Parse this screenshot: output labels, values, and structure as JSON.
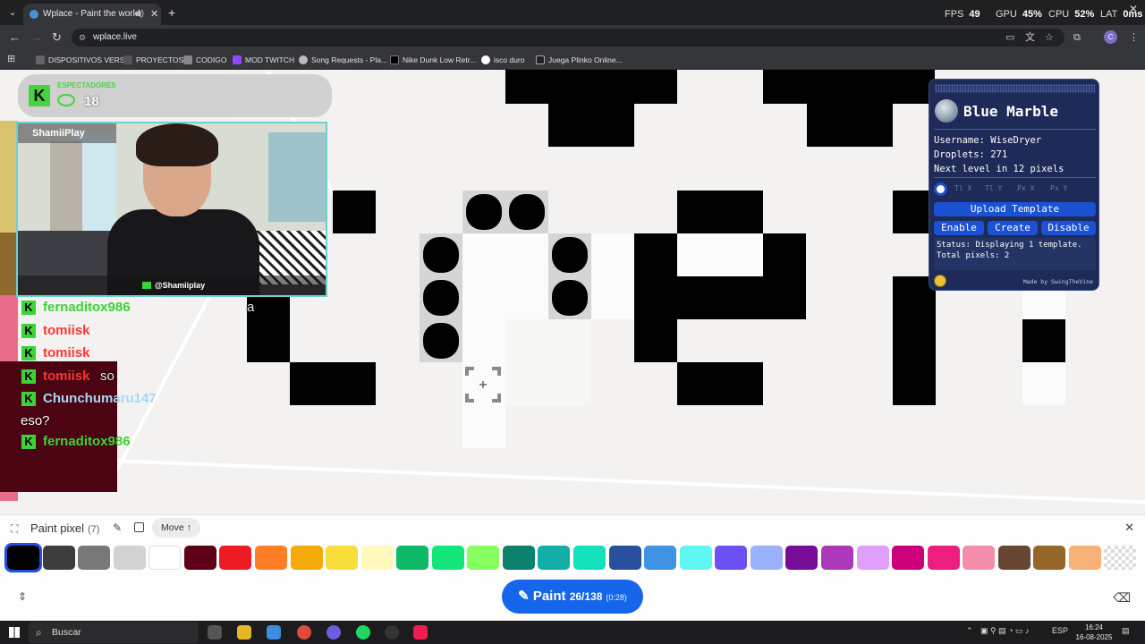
{
  "browser": {
    "tab_title": "Wplace - Paint the world",
    "url": "wplace.live",
    "hud": {
      "fps_label": "FPS",
      "fps": "49",
      "gpu_label": "GPU",
      "gpu": "45%",
      "cpu_label": "CPU",
      "cpu": "52%",
      "lat_label": "LAT",
      "lat": "0ms"
    },
    "profile_initial": "C",
    "bookmarks": [
      "DISPOSITIVOS VERSE",
      "PROYECTOS",
      "CODIGO",
      "MOD TWITCH",
      "Song Requests - Pla...",
      "Nike Dunk Low Retr...",
      "isco duro",
      "Juega Plinko Online..."
    ]
  },
  "stream": {
    "viewers_label": "ESPECTADORES",
    "viewers": "18",
    "streamer_name": "ShamiiPlay",
    "handle": "@Shamiiplay",
    "chat": [
      {
        "user": "fernaditox986",
        "color": "#3cd337",
        "message": "a"
      },
      {
        "user": "tomiisk",
        "color": "#ff3333",
        "message": ""
      },
      {
        "user": "tomiisk",
        "color": "#ff3333",
        "message": ""
      },
      {
        "user": "tomiisk",
        "color": "#ff3333",
        "message": "so"
      },
      {
        "user": "Chunchumaru147",
        "color": "#a7d8f5",
        "message": ""
      }
    ],
    "chat_continuation": "eso?",
    "chat_last": {
      "user": "fernaditox986",
      "color": "#3cd337"
    }
  },
  "blue_marble": {
    "title": "Blue Marble",
    "username": "Username: WiseDryer",
    "droplets": "Droplets: 271",
    "next_level": "Next level in 12 pixels",
    "coord_inputs": [
      "Tl X",
      "Tl Y",
      "Px X",
      "Px Y"
    ],
    "upload_label": "Upload Template",
    "enable_label": "Enable",
    "create_label": "Create",
    "disable_label": "Disable",
    "status_text": "Status: Displaying 1 template.\nTotal pixels: 2",
    "credit": "Made by SwingTheVine"
  },
  "paint_bar": {
    "title": "Paint pixel",
    "count": "(7)",
    "move_label": "Move ↑",
    "paint_label": "Paint",
    "paint_progress": "26/138",
    "paint_timer": "(0:28)",
    "selected_color": "#000000",
    "palette": [
      "#000000",
      "#3c3c3c",
      "#787878",
      "#d2d2d2",
      "#ffffff",
      "#600018",
      "#ed1c24",
      "#ff7f27",
      "#f6aa09",
      "#f9dd3b",
      "#fffabc",
      "#0eb968",
      "#13e67b",
      "#87ff5e",
      "#0c816e",
      "#10aea6",
      "#13e1be",
      "#28509e",
      "#4093e4",
      "#60f7f2",
      "#6b50f6",
      "#99b1fb",
      "#780c99",
      "#aa38b9",
      "#e09ff9",
      "#cb007a",
      "#ec1f80",
      "#f38da9",
      "#684634",
      "#95682a",
      "#f8b277",
      "transparent"
    ]
  },
  "taskbar": {
    "search_placeholder": "Buscar",
    "lang": "ESP",
    "time": "16:24",
    "date": "16-08-2025"
  }
}
